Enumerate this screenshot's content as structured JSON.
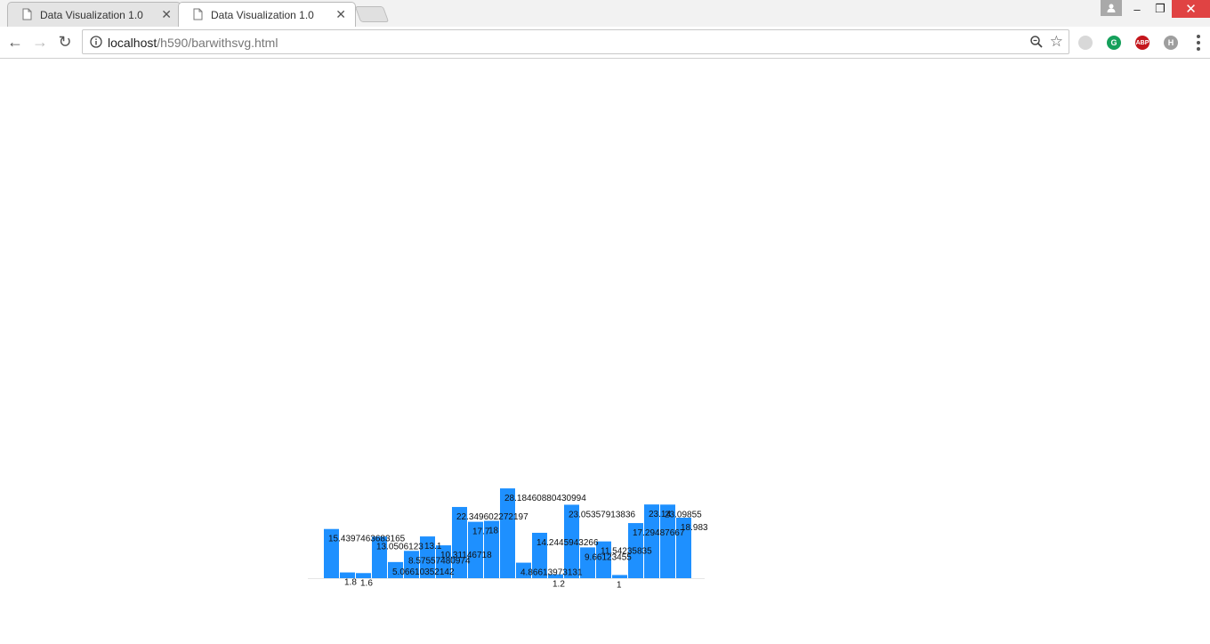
{
  "browser": {
    "tabs": [
      {
        "title": "Data Visualization 1.0",
        "active": false
      },
      {
        "title": "Data Visualization 1.0",
        "active": true
      }
    ],
    "address": {
      "host": "localhost",
      "path": "/h590/barwithsvg.html"
    },
    "extensions": [
      "G",
      "ABP",
      "H"
    ]
  },
  "colors": {
    "bar": "#1e90ff",
    "close": "#e04343"
  },
  "chart_data": {
    "type": "bar",
    "title": "",
    "xlabel": "",
    "ylabel": "",
    "ylim": [
      0,
      30
    ],
    "grid": false,
    "values": [
      15.4397463683165,
      1.8,
      1.6,
      13.0506123,
      5.06610352142,
      8.57557480974,
      13.1,
      10.31146718,
      22.349602272197,
      17.7,
      18.0,
      28.18460880430994,
      4.86613973131,
      14.2445943266,
      1.2,
      23.05357913836,
      9.66123455,
      11.54235835,
      1.0,
      17.29487667,
      23.14,
      23.09855,
      18.983
    ]
  }
}
